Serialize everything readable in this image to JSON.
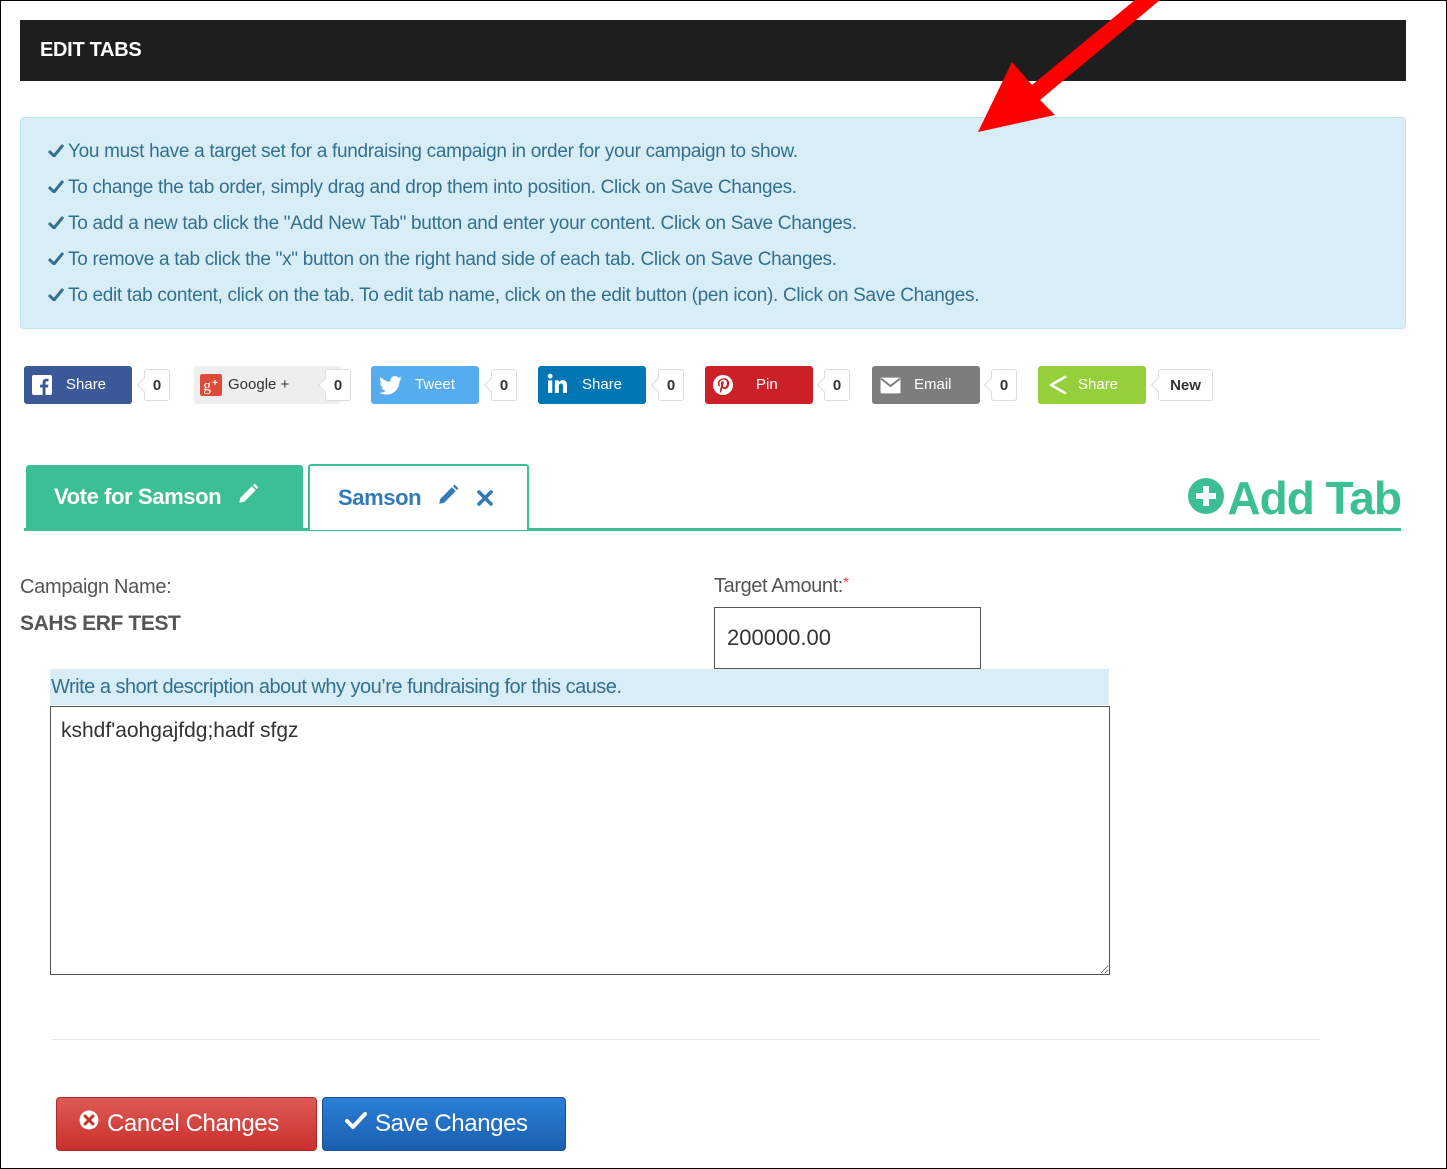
{
  "header": {
    "title": "EDIT TABS"
  },
  "info": {
    "lines": [
      "You must have a target set for a fundraising campaign in order for your campaign to show.",
      "To change the tab order, simply drag and drop them into position. Click on Save Changes.",
      "To add a new tab click the \"Add New Tab\" button and enter your content. Click on Save Changes.",
      "To remove a tab click the \"x\" button on the right hand side of each tab. Click on Save Changes.",
      "To edit tab content, click on the tab. To edit tab name, click on the edit button (pen icon). Click on Save Changes."
    ]
  },
  "share": {
    "facebook": {
      "label": "Share",
      "count": "0",
      "color": "#3b5998"
    },
    "google": {
      "label": "Google +",
      "count": "0",
      "color": "#dd4b39"
    },
    "twitter": {
      "label": "Tweet",
      "count": "0",
      "color": "#55acee"
    },
    "linkedin": {
      "label": "Share",
      "count": "0",
      "color": "#0077b5"
    },
    "pinterest": {
      "label": "Pin",
      "count": "0",
      "color": "#cb2027"
    },
    "email": {
      "label": "Email",
      "count": "0",
      "color": "#7d7d7d"
    },
    "sharethis": {
      "label": "Share",
      "count": "New",
      "color": "#95d03a"
    }
  },
  "tabs": [
    {
      "label": "Vote for Samson",
      "active": true
    },
    {
      "label": "Samson",
      "active": false
    }
  ],
  "add_tab": {
    "label": "Add Tab"
  },
  "form": {
    "campaign_label": "Campaign Name:",
    "campaign_value": "SAHS ERF TEST",
    "target_label": "Target Amount:",
    "target_required": "*",
    "target_value": "200000.00",
    "description_hint": "Write a short description about why you’re fundraising for this cause.",
    "description_value": "kshdf'aohgajfdg;hadf sfgz"
  },
  "buttons": {
    "cancel": "Cancel Changes",
    "save": "Save Changes"
  },
  "colors": {
    "accent": "#3cbf94",
    "header_bg": "#1e1e1e",
    "info_bg": "#d9edf7",
    "annotation_arrow": "#ff0000"
  }
}
